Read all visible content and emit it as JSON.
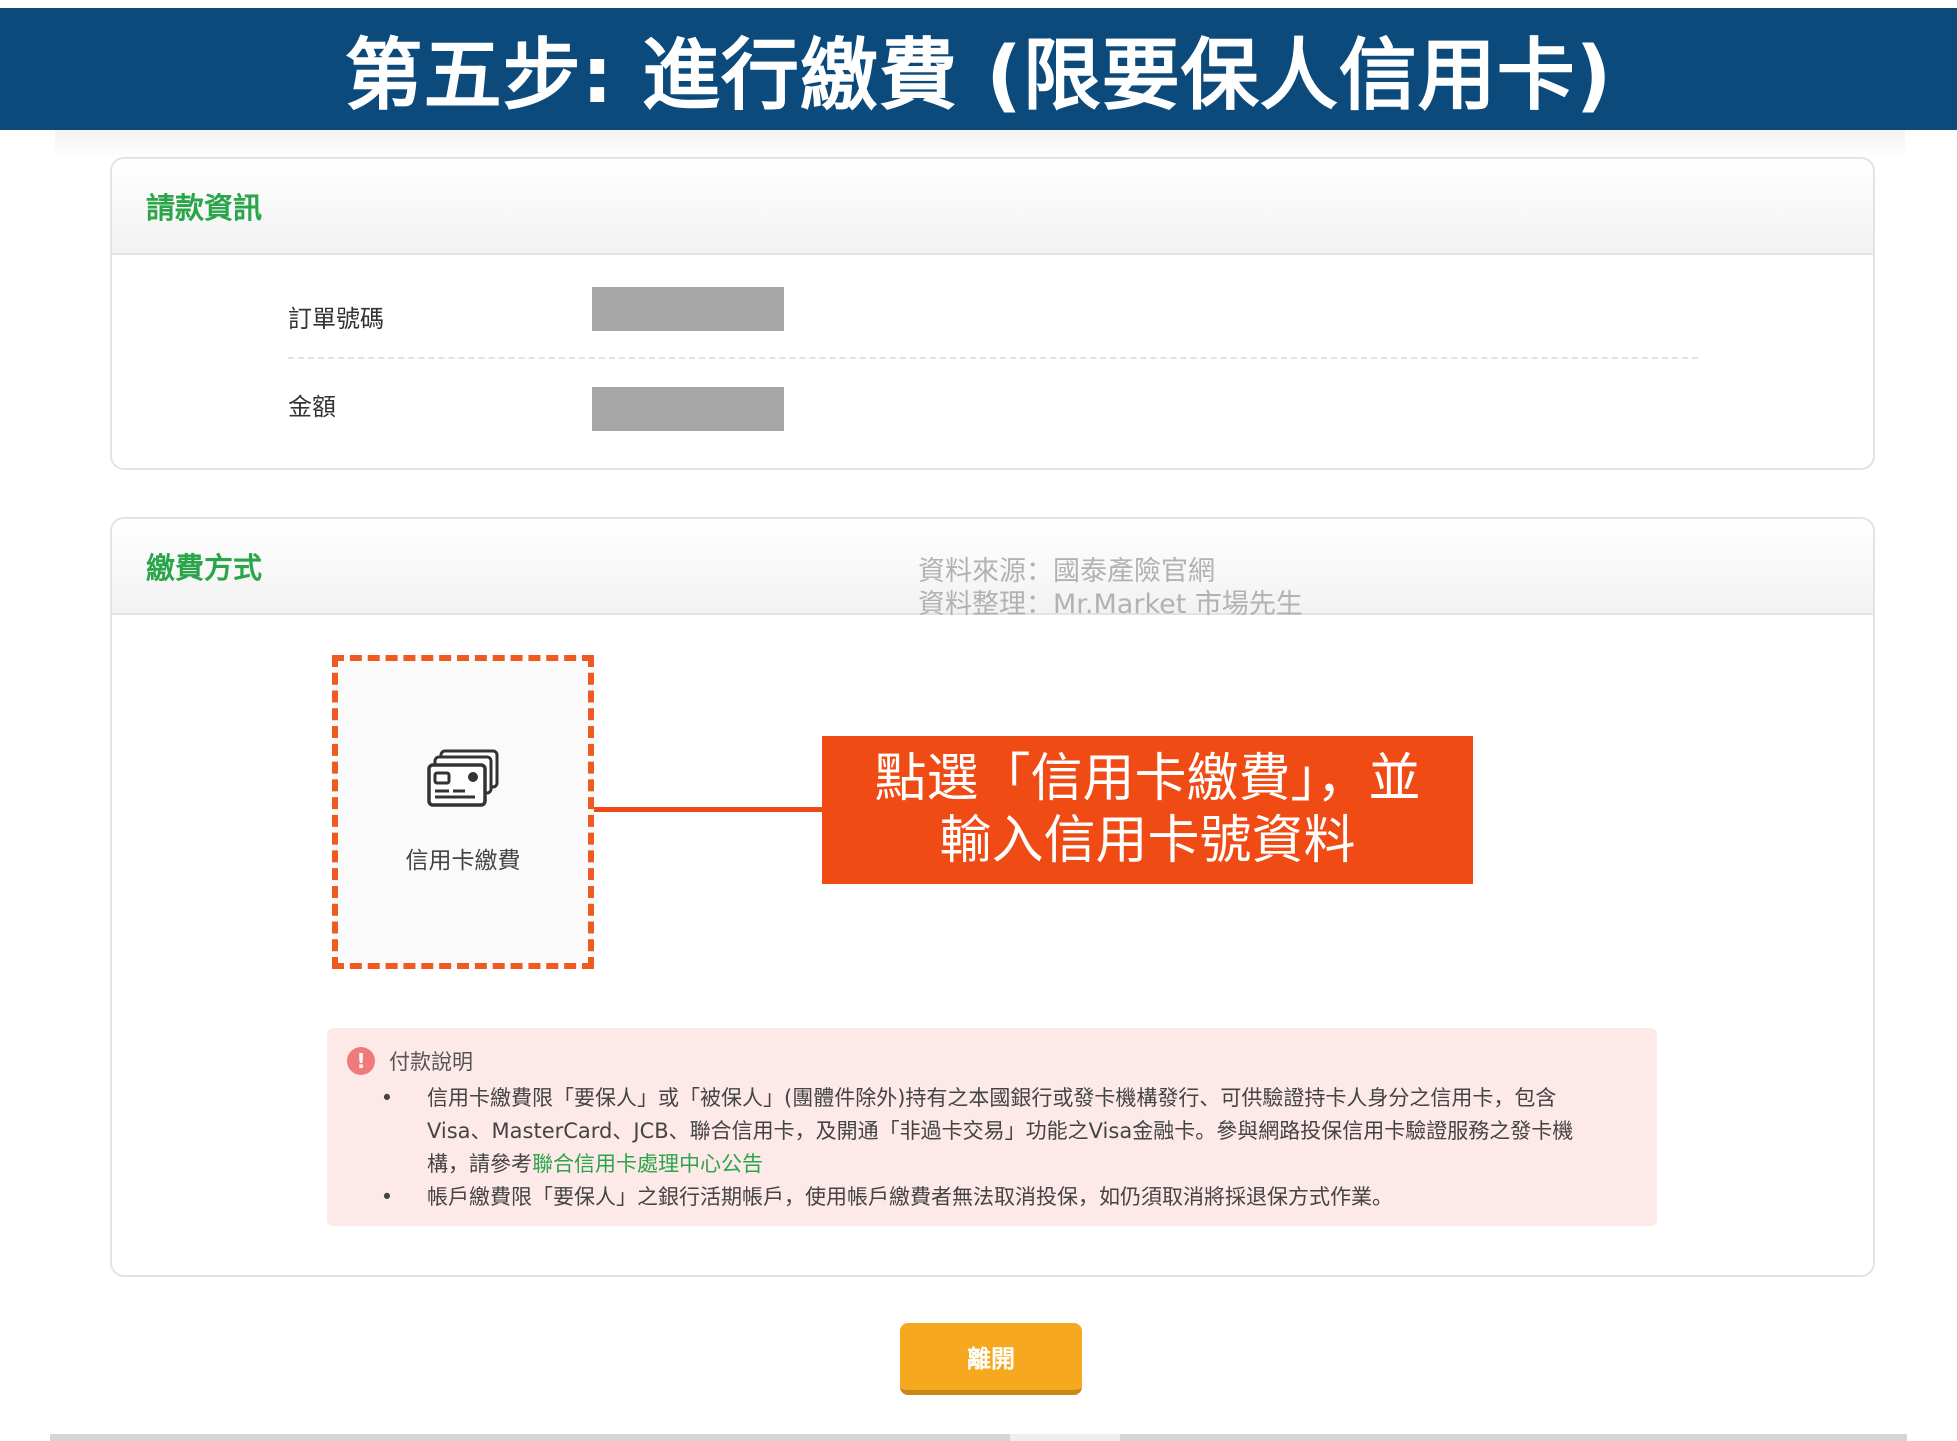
{
  "banner": {
    "title": "第五步: 進行繳費 (限要保人信用卡)"
  },
  "billing": {
    "title": "請款資訊",
    "order_label": "訂單號碼",
    "amount_label": "金額"
  },
  "payment": {
    "title": "繳費方式",
    "watermark_line1": "資料來源：國泰產險官網",
    "watermark_line2": "資料整理：Mr.Market 市場先生",
    "option_label": "信用卡繳費",
    "option_icon": "credit-card-icon",
    "callout_line1": "點選「信用卡繳費」，並",
    "callout_line2": "輸入信用卡號資料",
    "notice_title": "付款說明",
    "notice_bullet1_part1": "信用卡繳費限「要保人」或「被保人」(團體件除外)持有之本國銀行或發卡機構發行、可供驗證持卡人身分之信用卡，包含Visa、MasterCard、JCB、聯合信用卡，及開通「非過卡交易」功能之Visa金融卡。參與網路投保信用卡驗證服務之發卡機構，請參考",
    "notice_bullet1_link": "聯合信用卡處理中心公告",
    "notice_bullet2": "帳戶繳費限「要保人」之銀行活期帳戶，使用帳戶繳費者無法取消投保，如仍須取消將採退保方式作業。"
  },
  "actions": {
    "leave_label": "離開"
  },
  "colors": {
    "banner": "#0c4a7c",
    "accent_green": "#2aa54a",
    "callout": "#f04b14",
    "button": "#f6a81e"
  }
}
